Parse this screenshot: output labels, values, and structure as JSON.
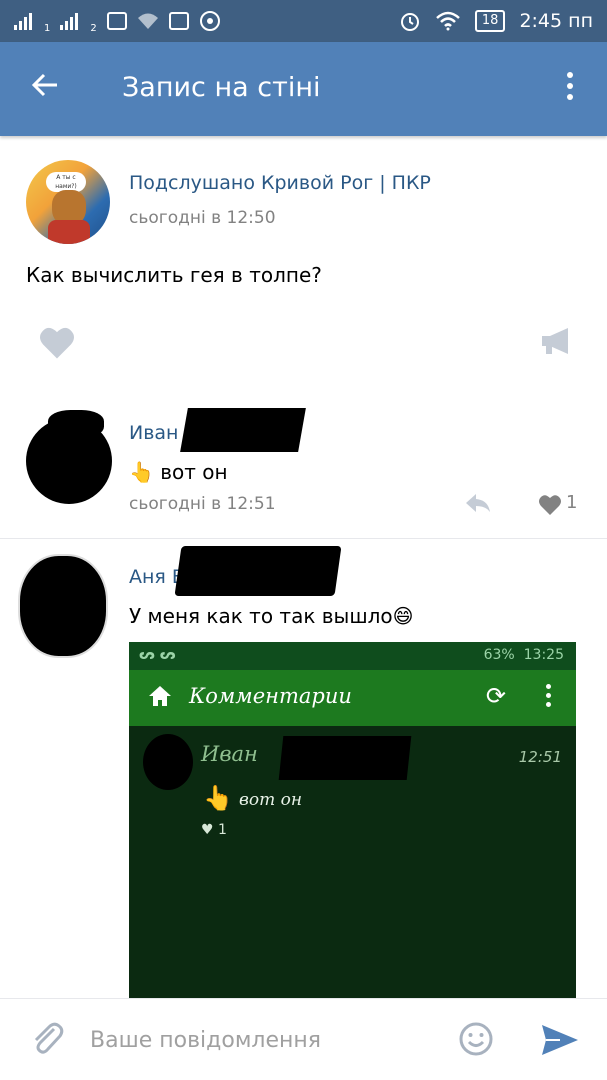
{
  "status_bar": {
    "sim1": "1",
    "sim2": "2",
    "battery": "18",
    "time": "2:45 пп"
  },
  "app_bar": {
    "title": "Запис на стіні"
  },
  "post": {
    "group_name": "Подслушано Кривой Рог | ПКР",
    "avatar_text": "А ты с нами?)",
    "time": "сьогодні в 12:50",
    "text": "Как вычислить гея в толпе?"
  },
  "comments": [
    {
      "author": "Иван",
      "emoji": "👆",
      "text": "вот он",
      "time": "сьогодні в 12:51",
      "likes": "1"
    },
    {
      "author": "Аня Б",
      "text": "У меня как то так вышло",
      "emoji": "😄",
      "screenshot": {
        "status_left": "ᔕ ᔕ",
        "status_battery": "63%",
        "status_time": "13:25",
        "title": "Комментарии",
        "comment_author": "Иван",
        "comment_time": "12:51",
        "comment_text": "вот он",
        "comment_likes": "1"
      }
    }
  ],
  "composer": {
    "placeholder": "Ваше повідомлення"
  },
  "colors": {
    "status_bar": "#3f5f82",
    "app_bar": "#5181b8",
    "link": "#2a5885",
    "muted": "#828282"
  }
}
